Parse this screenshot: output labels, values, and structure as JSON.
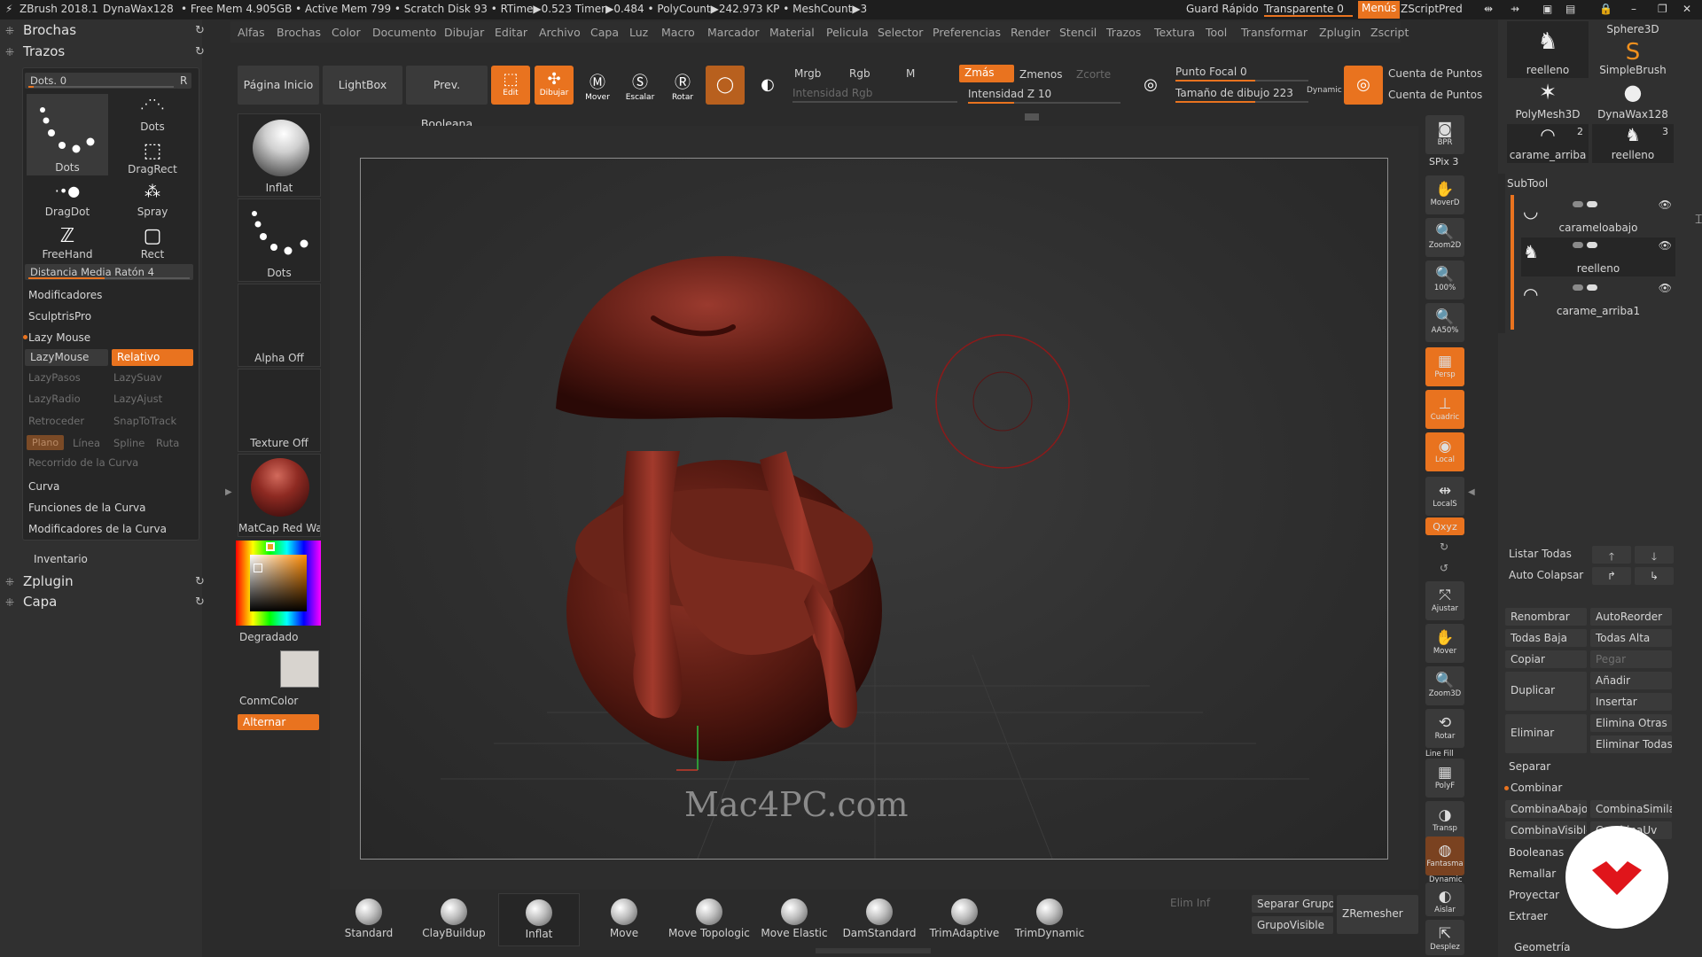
{
  "titlebar": {
    "app": "ZBrush 2018.1",
    "doc": "DynaWax128",
    "stats": "• Free Mem 4.905GB • Active Mem 799 • Scratch Disk 93 • RTime▶0.523 Timer▶0.484 • PolyCount▶242.973 KP • MeshCount▶3",
    "quicksave": "Guard Rápido",
    "transparent": "Transparente 0",
    "menus": "Menús",
    "script": "ZScriptPred"
  },
  "menubar": [
    "Alfas",
    "Brochas",
    "Color",
    "Documento",
    "Dibujar",
    "Editar",
    "Archivo",
    "Capa",
    "Luz",
    "Macro",
    "Marcador",
    "Material",
    "Pelicula",
    "Selector",
    "Preferencias",
    "Render",
    "Stencil",
    "Trazos",
    "Textura",
    "Tool",
    "Transformar",
    "Zplugin",
    "Zscript"
  ],
  "lefttray": {
    "brushes": "Brochas",
    "strokes": "Trazos",
    "dots_slider": "Dots. 0",
    "r_btn": "R",
    "stroke_types": [
      "Dots",
      "Dots",
      "DragRect",
      "DragDot",
      "Spray",
      "FreeHand",
      "Rect"
    ],
    "mouse_distance": "Distancia Media Ratón 4",
    "rows": [
      "Modificadores",
      "SculptrisPro",
      "Lazy Mouse"
    ],
    "lazymouse": "LazyMouse",
    "relative": "Relativo",
    "lazy_params": [
      "LazyPasos",
      "LazySuav",
      "LazyRadio",
      "LazyAjust",
      "Retroceder",
      "SnapToTrack"
    ],
    "curve_modes": [
      "Plano",
      "Línea",
      "Spline",
      "Ruta"
    ],
    "curve_path": "Recorrido de la Curva",
    "curve_rows": [
      "Curva",
      "Funciones de la Curva",
      "Modificadores de la Curva"
    ],
    "inventory": "Inventario",
    "zplugin": "Zplugin",
    "layer": "Capa"
  },
  "material_column": {
    "brush": "Inflat",
    "stroke": "Dots",
    "alpha": "Alpha Off",
    "texture": "Texture Off",
    "material": "MatCap Red Wax",
    "gradient": "Degradado",
    "color": "ConmColor",
    "alternate": "Alternar"
  },
  "topshelf": {
    "home": "Página Inicio",
    "lightbox": "LightBox",
    "boolean": "Prev. Booleana",
    "edit": "Edit",
    "draw": "Dibujar",
    "move": "Mover",
    "scale": "Escalar",
    "rotate": "Rotar",
    "mrgb": "Mrgb",
    "rgb": "Rgb",
    "m": "M",
    "rgb_intensity": "Intensidad Rgb",
    "zadd": "Zmás",
    "zsub": "Zmenos",
    "zcut": "Zcorte",
    "z_intensity": "Intensidad Z 10",
    "focal": "Punto Focal 0",
    "draw_size": "Tamaño de dibujo 223",
    "dynamic": "Dynamic",
    "point_count1": "Cuenta de Puntos",
    "point_count2": "Cuenta de Puntos"
  },
  "viewport": {
    "watermark": "Mac4PC.com"
  },
  "rightshelf": [
    {
      "icon": "bpr-icon",
      "label": "BPR"
    },
    {
      "icon": "spix-icon",
      "label": "SPix 3"
    },
    {
      "icon": "move2d-icon",
      "label": "MoverD"
    },
    {
      "icon": "zoom2d-icon",
      "label": "Zoom2D"
    },
    {
      "icon": "zoom100-icon",
      "label": "100%"
    },
    {
      "icon": "aahalf-icon",
      "label": "AA50%"
    },
    {
      "icon": "persp-icon",
      "label": "Persp"
    },
    {
      "icon": "floor-icon",
      "label": "Cuadric"
    },
    {
      "icon": "local-icon",
      "label": "Local"
    },
    {
      "icon": "localsym-icon",
      "label": "LocalS"
    },
    {
      "icon": "xyz-icon",
      "label": "Qxyz"
    },
    {
      "icon": "frame-icon",
      "label": "Ajustar"
    },
    {
      "icon": "move-icon",
      "label": "Mover"
    },
    {
      "icon": "zoom3d-icon",
      "label": "Zoom3D"
    },
    {
      "icon": "rotate-icon",
      "label": "Rotar"
    },
    {
      "icon": "polyf-icon",
      "label": "PolyF"
    },
    {
      "icon": "transp-icon",
      "label": "Transp"
    },
    {
      "icon": "ghost-icon",
      "label": "Fantasma"
    },
    {
      "icon": "solo-icon",
      "label": "Aislar"
    },
    {
      "icon": "xpose-icon",
      "label": "Desplez"
    }
  ],
  "rightshelf_extra": {
    "linefill": "Line Fill",
    "dynamic": "Dynamic",
    "dynamic2": "Dynamic"
  },
  "righttray": {
    "tools": [
      {
        "label": "reelleno",
        "count": ""
      },
      {
        "label": "Sphere3D",
        "count": ""
      },
      {
        "label": "SimpleBrush",
        "count": ""
      },
      {
        "label": "PolyMesh3D",
        "count": ""
      },
      {
        "label": "DynaWax128",
        "count": ""
      },
      {
        "label": "carame_arriba",
        "count": "2"
      },
      {
        "label": "reelleno",
        "count": "3"
      }
    ],
    "subtool_title": "SubTool",
    "subtools": [
      "carameloabajo",
      "reelleno",
      "carame_arriba1"
    ],
    "list_all": "Listar Todas",
    "auto_collapse": "Auto Colapsar",
    "buttons": {
      "rename": "Renombrar",
      "autoreorder": "AutoReorder",
      "all_low": "Todas Baja",
      "all_high": "Todas Alta",
      "copy": "Copiar",
      "paste": "Pegar",
      "duplicate": "Duplicar",
      "append": "Añadir",
      "insert": "Insertar",
      "delete": "Eliminar",
      "delete_other": "Elimina Otras",
      "delete_all": "Eliminar Todas",
      "split": "Separar",
      "merge": "Combinar",
      "merge_down": "CombinaAbajo",
      "merge_similar": "CombinaSimilar",
      "merge_visible": "CombinaVisible",
      "merge_uv": "CombinaUv",
      "boolean": "Booleanas",
      "remesh": "Remallar",
      "project": "Proyectar",
      "extract": "Extraer",
      "geometry": "Geometría"
    }
  },
  "bottomshelf": {
    "brushes": [
      "Standard",
      "ClayBuildup",
      "Inflat",
      "Move",
      "Move Topologica",
      "Move Elastic",
      "DamStandard",
      "TrimAdaptive",
      "TrimDynamic"
    ],
    "del_lower": "Elim Inf",
    "split_groups": "Separar Grupo",
    "group_visible": "GrupoVisible",
    "zremesher": "ZRemesher"
  }
}
